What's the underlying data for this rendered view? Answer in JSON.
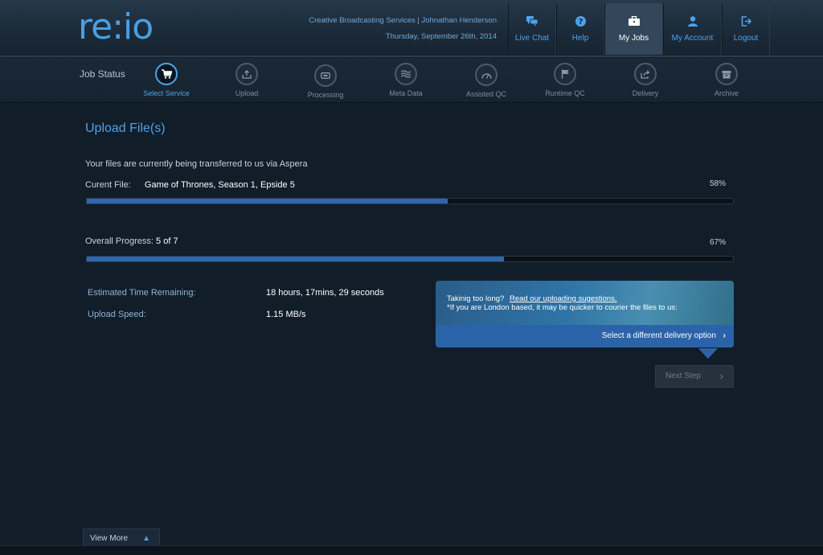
{
  "header": {
    "logo": "re:io",
    "user_line": "Creative Broadcasting Services  | Johnathan Henderson",
    "date_line": "Thursday, September 26th, 2014",
    "nav": [
      {
        "label": "Live Chat",
        "icon": "chat-icon"
      },
      {
        "label": "Help",
        "icon": "help-icon"
      },
      {
        "label": "My Jobs",
        "icon": "briefcase-icon",
        "active": true
      },
      {
        "label": "My Account",
        "icon": "user-icon"
      },
      {
        "label": "Logout",
        "icon": "logout-icon"
      }
    ]
  },
  "steps": {
    "label": "Job Status",
    "items": [
      {
        "label": "Select Service",
        "icon": "cart-icon",
        "active": true
      },
      {
        "label": "Upload",
        "icon": "upload-icon"
      },
      {
        "label": "Processing",
        "icon": "processing-icon"
      },
      {
        "label": "Meta Data",
        "icon": "waves-icon"
      },
      {
        "label": "Assisted QC",
        "icon": "gauge-icon"
      },
      {
        "label": "Runtime QC",
        "icon": "flag-icon"
      },
      {
        "label": "Delivery",
        "icon": "share-icon"
      },
      {
        "label": "Archive",
        "icon": "archive-icon"
      }
    ]
  },
  "main": {
    "title": "Upload File(s)",
    "transfer_msg": "Your files are currently being transferred to us via Aspera",
    "current_file_label": "Curent File:",
    "current_file_name": "Game of Thrones, Season 1, Epside 5",
    "current_pct": "58%",
    "current_progress": 0.558,
    "overall_label": "Overall Progress:",
    "overall_value": "5 of 7",
    "overall_pct": "67%",
    "overall_progress": 0.646,
    "eta_label": "Estimated Time Remaining:",
    "eta_value": "18 hours, 17mins, 29 seconds",
    "speed_label": "Upload Speed:",
    "speed_value": "1.15 MB/s"
  },
  "promo": {
    "line1": "Takinig too long?",
    "link": "Read our uploading sugestions.",
    "line2": "*If you are London based, it may be quicker to courier the files to us:",
    "action": "Select a different delivery option"
  },
  "next_step": "Next Step",
  "footer": {
    "view_more": "View More"
  },
  "colors": {
    "accent": "#4ea3ea",
    "progress": "#2d67b0",
    "background": "#111d29"
  }
}
